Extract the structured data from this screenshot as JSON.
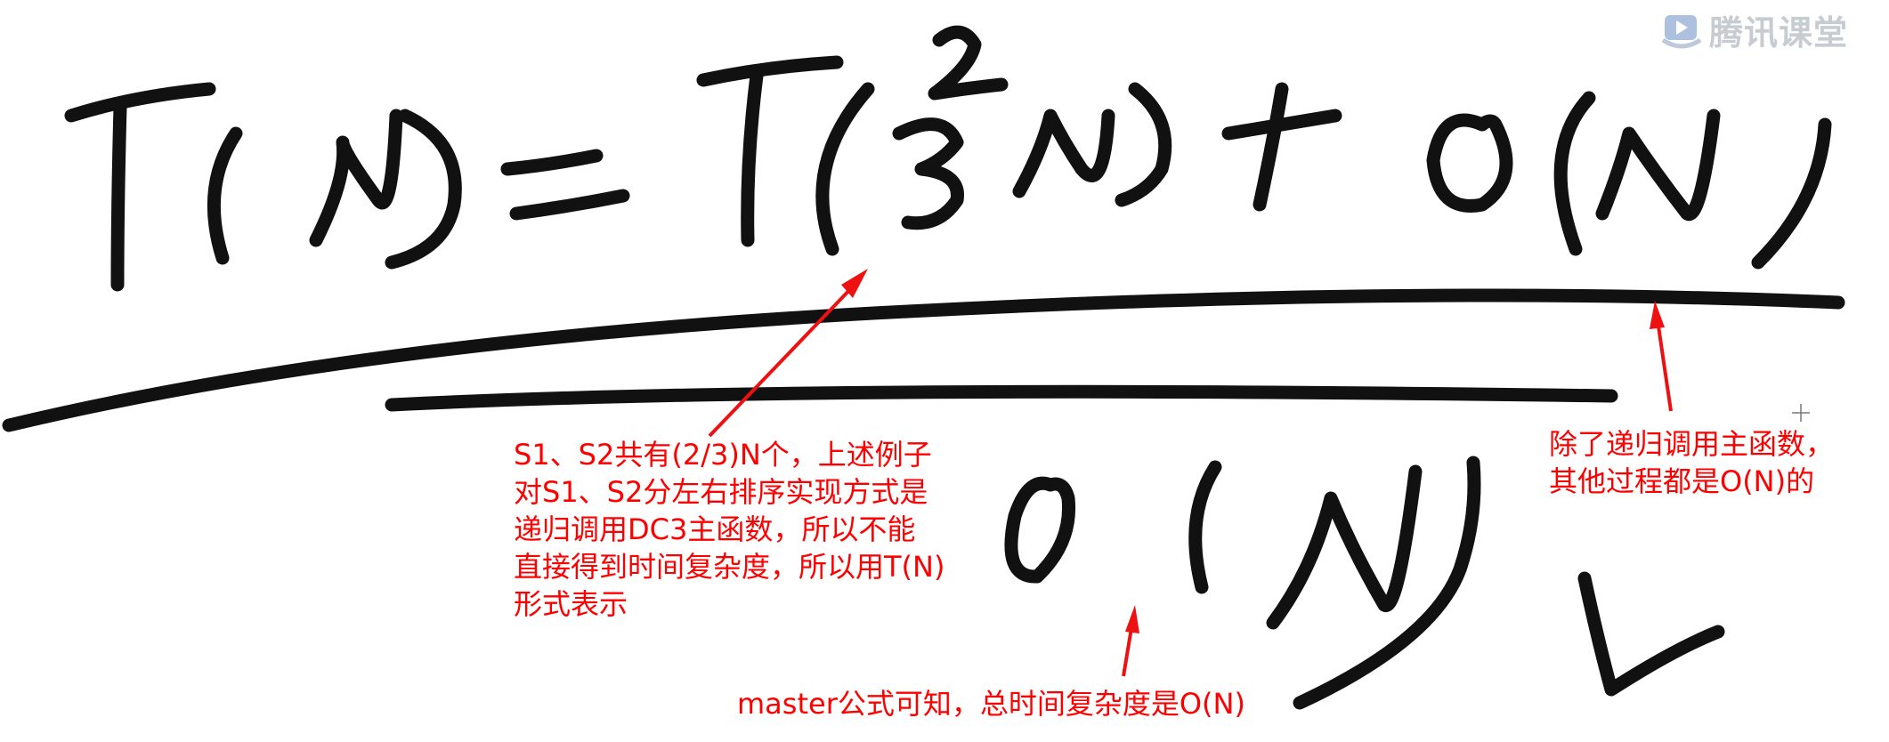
{
  "watermark": {
    "brand_text": "腾讯课堂",
    "logo_icon": "tencent-classroom-play-logo"
  },
  "handwriting": {
    "recurrence": "T(N) = T(2/3 N) + O(N)",
    "result": "O(N)",
    "check_mark": "✓",
    "ink_color": "#111111"
  },
  "annotations": {
    "color": "#ff0000",
    "left_note": "S1、S2共有(2/3)N个，上述例子\n对S1、S2分左右排序实现方式是\n递归调用DC3主函数，所以不能\n直接得到时间复杂度，所以用T(N)\n形式表示",
    "right_note": "除了递归调用主函数，\n其他过程都是O(N)的",
    "bottom_note": "master公式可知，总时间复杂度是O(N)"
  }
}
